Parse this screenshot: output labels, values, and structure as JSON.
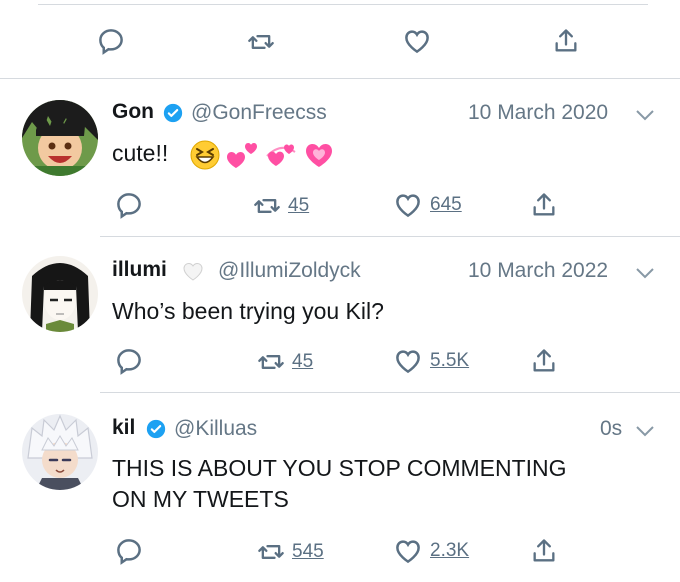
{
  "top_actions": {
    "reply_icon": "reply-icon",
    "retweet_icon": "retweet-icon",
    "like_icon": "heart-icon",
    "share_icon": "share-icon"
  },
  "tweets": [
    {
      "name": "Gon",
      "verified": true,
      "handle": "@GonFreecss",
      "time": "10 March 2020",
      "text": "cute!!",
      "emojis": [
        "grinning-squint-emoji",
        "two-hearts-emoji",
        "revolving-hearts-emoji",
        "growing-heart-emoji"
      ],
      "retweets": "45",
      "likes": "645"
    },
    {
      "name": "illumi",
      "badge": "white-heart",
      "handle": "@IllumiZoldyck",
      "time": "10 March 2022",
      "text": "Who’s been trying you Kil?",
      "retweets": "45",
      "likes": "5.5K"
    },
    {
      "name": "kil",
      "verified": true,
      "handle": "@Killuas",
      "time": "0s",
      "text_line1": "THIS IS ABOUT YOU STOP COMMENTING",
      "text_line2": "ON MY TWEETS",
      "retweets": "545",
      "likes": "2.3K"
    }
  ],
  "colors": {
    "accent": "#1da1f2",
    "muted": "#657786",
    "icon": "#5b7083",
    "divider": "#d6dadf"
  }
}
